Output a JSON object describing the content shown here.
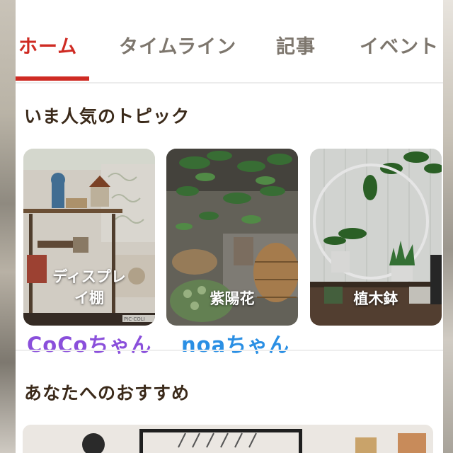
{
  "tabs": [
    {
      "label": "ホーム",
      "active": true
    },
    {
      "label": "タイムライン",
      "active": false
    },
    {
      "label": "記事",
      "active": false
    },
    {
      "label": "イベント",
      "active": false
    }
  ],
  "popular_topics": {
    "title": "いま人気のトピック",
    "cards": [
      {
        "label": "ディスプレイ棚",
        "line1": "ディスプレ",
        "line2": "イ棚"
      },
      {
        "label": "紫陽花"
      },
      {
        "label": "植木鉢"
      }
    ],
    "watermark": "PIC·COLI"
  },
  "annotations": [
    {
      "text": "CoCoちゃん",
      "color": "#8a4fdb"
    },
    {
      "text": "noaちゃん",
      "color": "#2a8fe4"
    }
  ],
  "recommended": {
    "title": "あなたへのおすすめ"
  },
  "colors": {
    "accent": "#cf2b23",
    "tab_inactive": "#7d766d",
    "heading": "#3b2a1a"
  }
}
